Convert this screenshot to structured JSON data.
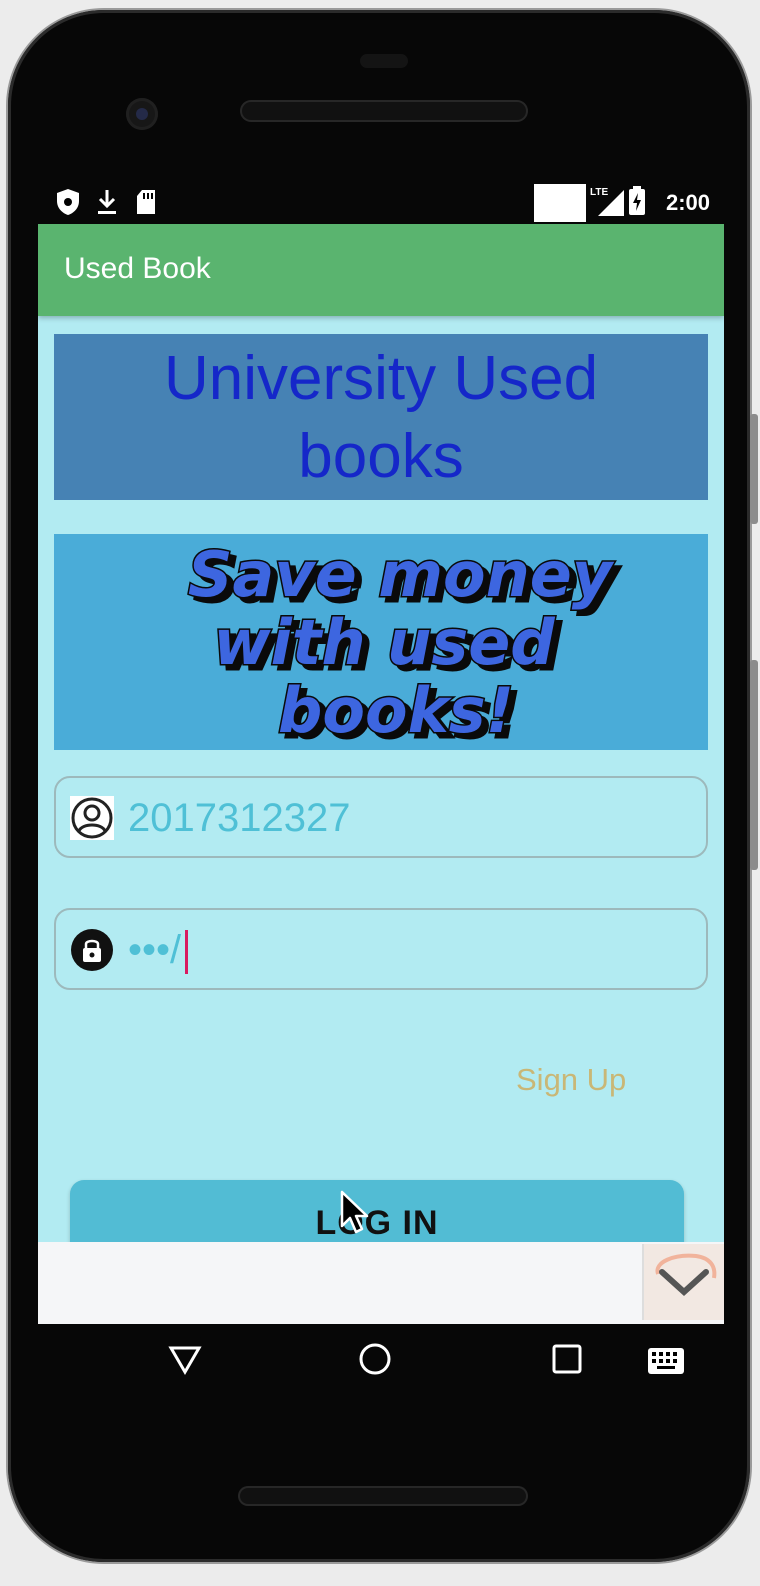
{
  "status_bar": {
    "time": "2:00",
    "network": "LTE",
    "icons": [
      "shield-icon",
      "download-icon",
      "sd-card-icon",
      "signal-icon",
      "battery-icon"
    ]
  },
  "app_bar": {
    "title": "Used Book"
  },
  "header": {
    "title_line1": "University Used",
    "title_line2": "books"
  },
  "banner": {
    "line1": "Save money",
    "line2": "with used",
    "line3": "books!"
  },
  "username_field": {
    "value": "2017312327",
    "icon": "person-icon"
  },
  "password_field": {
    "value": "•••/",
    "icon": "lock-icon"
  },
  "signup_link": {
    "label": "Sign Up"
  },
  "login_button": {
    "label": "LOG IN"
  },
  "nav_bar": {
    "buttons": [
      "back-icon",
      "home-icon",
      "recents-icon",
      "keyboard-icon"
    ]
  },
  "colors": {
    "app_bar": "#5ab46f",
    "screen_bg": "#b2ebf2",
    "header_bg": "#4682b4",
    "header_text": "#1527c9",
    "banner_bg": "#4aacd8",
    "banner_text": "#3d66e0",
    "input_text": "#4fc0d6",
    "signup_text": "#c9b776",
    "login_bg": "#52bcd4"
  }
}
